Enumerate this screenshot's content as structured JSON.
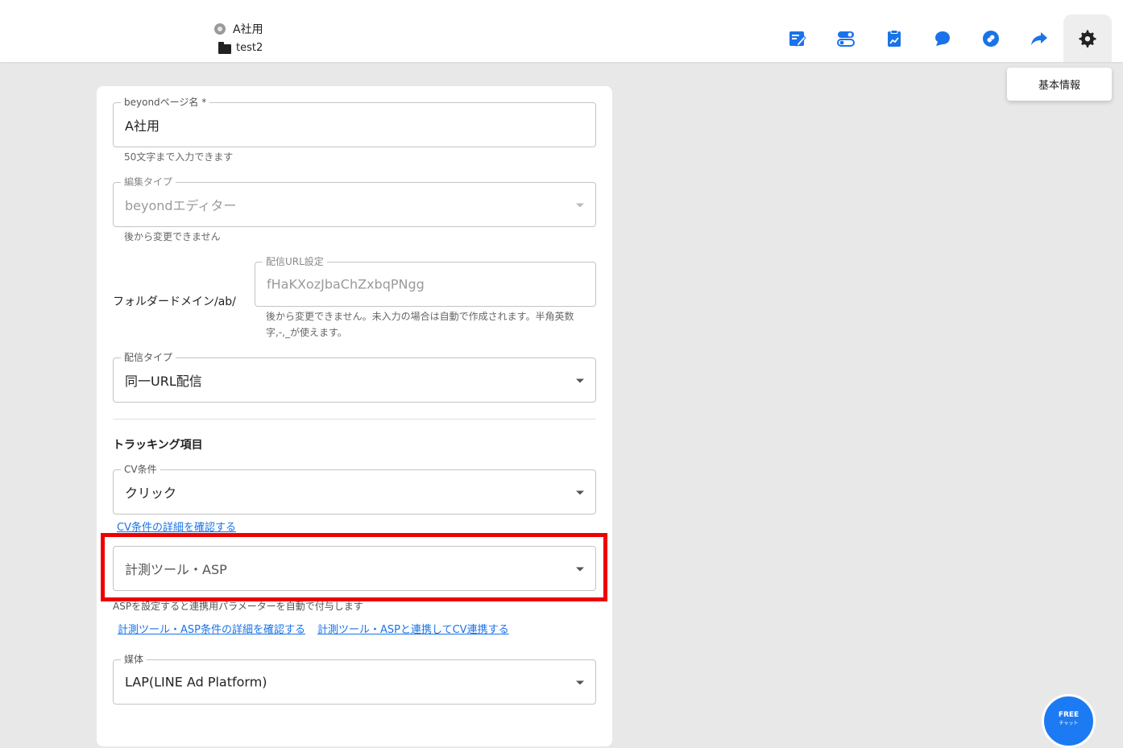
{
  "header": {
    "page_name": "A社用",
    "folder_name": "test2",
    "toolbar": [
      {
        "icon": "edit-note-icon"
      },
      {
        "icon": "toggle-switch-icon"
      },
      {
        "icon": "analytics-clipboard-icon"
      },
      {
        "icon": "chat-bubble-icon"
      },
      {
        "icon": "link-icon"
      },
      {
        "icon": "share-arrow-icon"
      },
      {
        "icon": "gear-icon",
        "active": true
      }
    ],
    "tooltip": "基本情報"
  },
  "form": {
    "page_name_field": {
      "label": "beyondページ名 *",
      "value": "A社用",
      "helper": "50文字まで入力できます"
    },
    "edit_type_field": {
      "label": "編集タイプ",
      "value": "beyondエディター",
      "helper": "後から変更できません"
    },
    "folder_domain_label": "フォルダードメイン/ab/",
    "url_field": {
      "label": "配信URL設定",
      "value": "fHaKXozJbaChZxbqPNgg",
      "helper_line1": "後から変更できません。未入力の場合は自動で作成されます。半角英数",
      "helper_line2": "字,-,_が使えます。"
    },
    "delivery_type_field": {
      "label": "配信タイプ",
      "value": "同一URL配信"
    },
    "tracking_heading": "トラッキング項目",
    "cv_condition_field": {
      "label": "CV条件",
      "value": "クリック"
    },
    "cv_detail_link": "CV条件の詳細を確認する",
    "tool_asp_field": {
      "placeholder": "計測ツール・ASP"
    },
    "asp_helper": "ASPを設定すると連携用パラメーターを自動で付与します",
    "asp_detail_link": "計測ツール・ASP条件の詳細を確認する",
    "asp_cv_link": "計測ツール・ASPと連携してCV連携する",
    "media_field": {
      "label": "媒体",
      "value": "LAP(LINE Ad Platform)"
    }
  },
  "chat_widget": {
    "label": "FREE",
    "sub": "チャット"
  },
  "colors": {
    "accent": "#1a73e8",
    "highlight": "#ee0000"
  }
}
